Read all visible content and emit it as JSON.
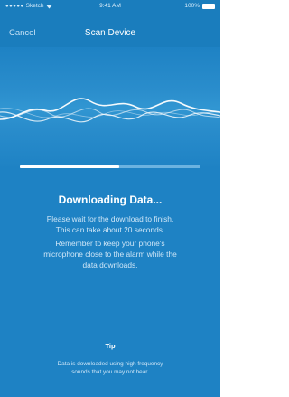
{
  "status_bar": {
    "carrier": "Sketch",
    "time": "9:41 AM",
    "battery": "100%"
  },
  "nav": {
    "cancel_label": "Cancel",
    "title": "Scan Device"
  },
  "progress": {
    "value_fraction": 0.55
  },
  "content": {
    "title": "Downloading Data...",
    "paragraph_1": [
      "Please wait for the download to finish.",
      "This can take about 20 seconds."
    ],
    "paragraph_2": [
      "Remember to keep your phone's",
      "microphone close to the alarm while the",
      "data downloads."
    ]
  },
  "tip": {
    "label": "Tip",
    "text": [
      "Data is downloaded using high frequency",
      "sounds that you may not hear."
    ]
  },
  "colors": {
    "background": "#1e82c4",
    "nav_background": "#1a7dbd",
    "progress_fill": "#ffffff",
    "progress_track": "#6cb3e0"
  },
  "icons": {
    "signal": "signal-dots-icon",
    "wifi": "wifi-icon",
    "battery": "battery-icon",
    "waveform": "sound-wave-icon"
  }
}
